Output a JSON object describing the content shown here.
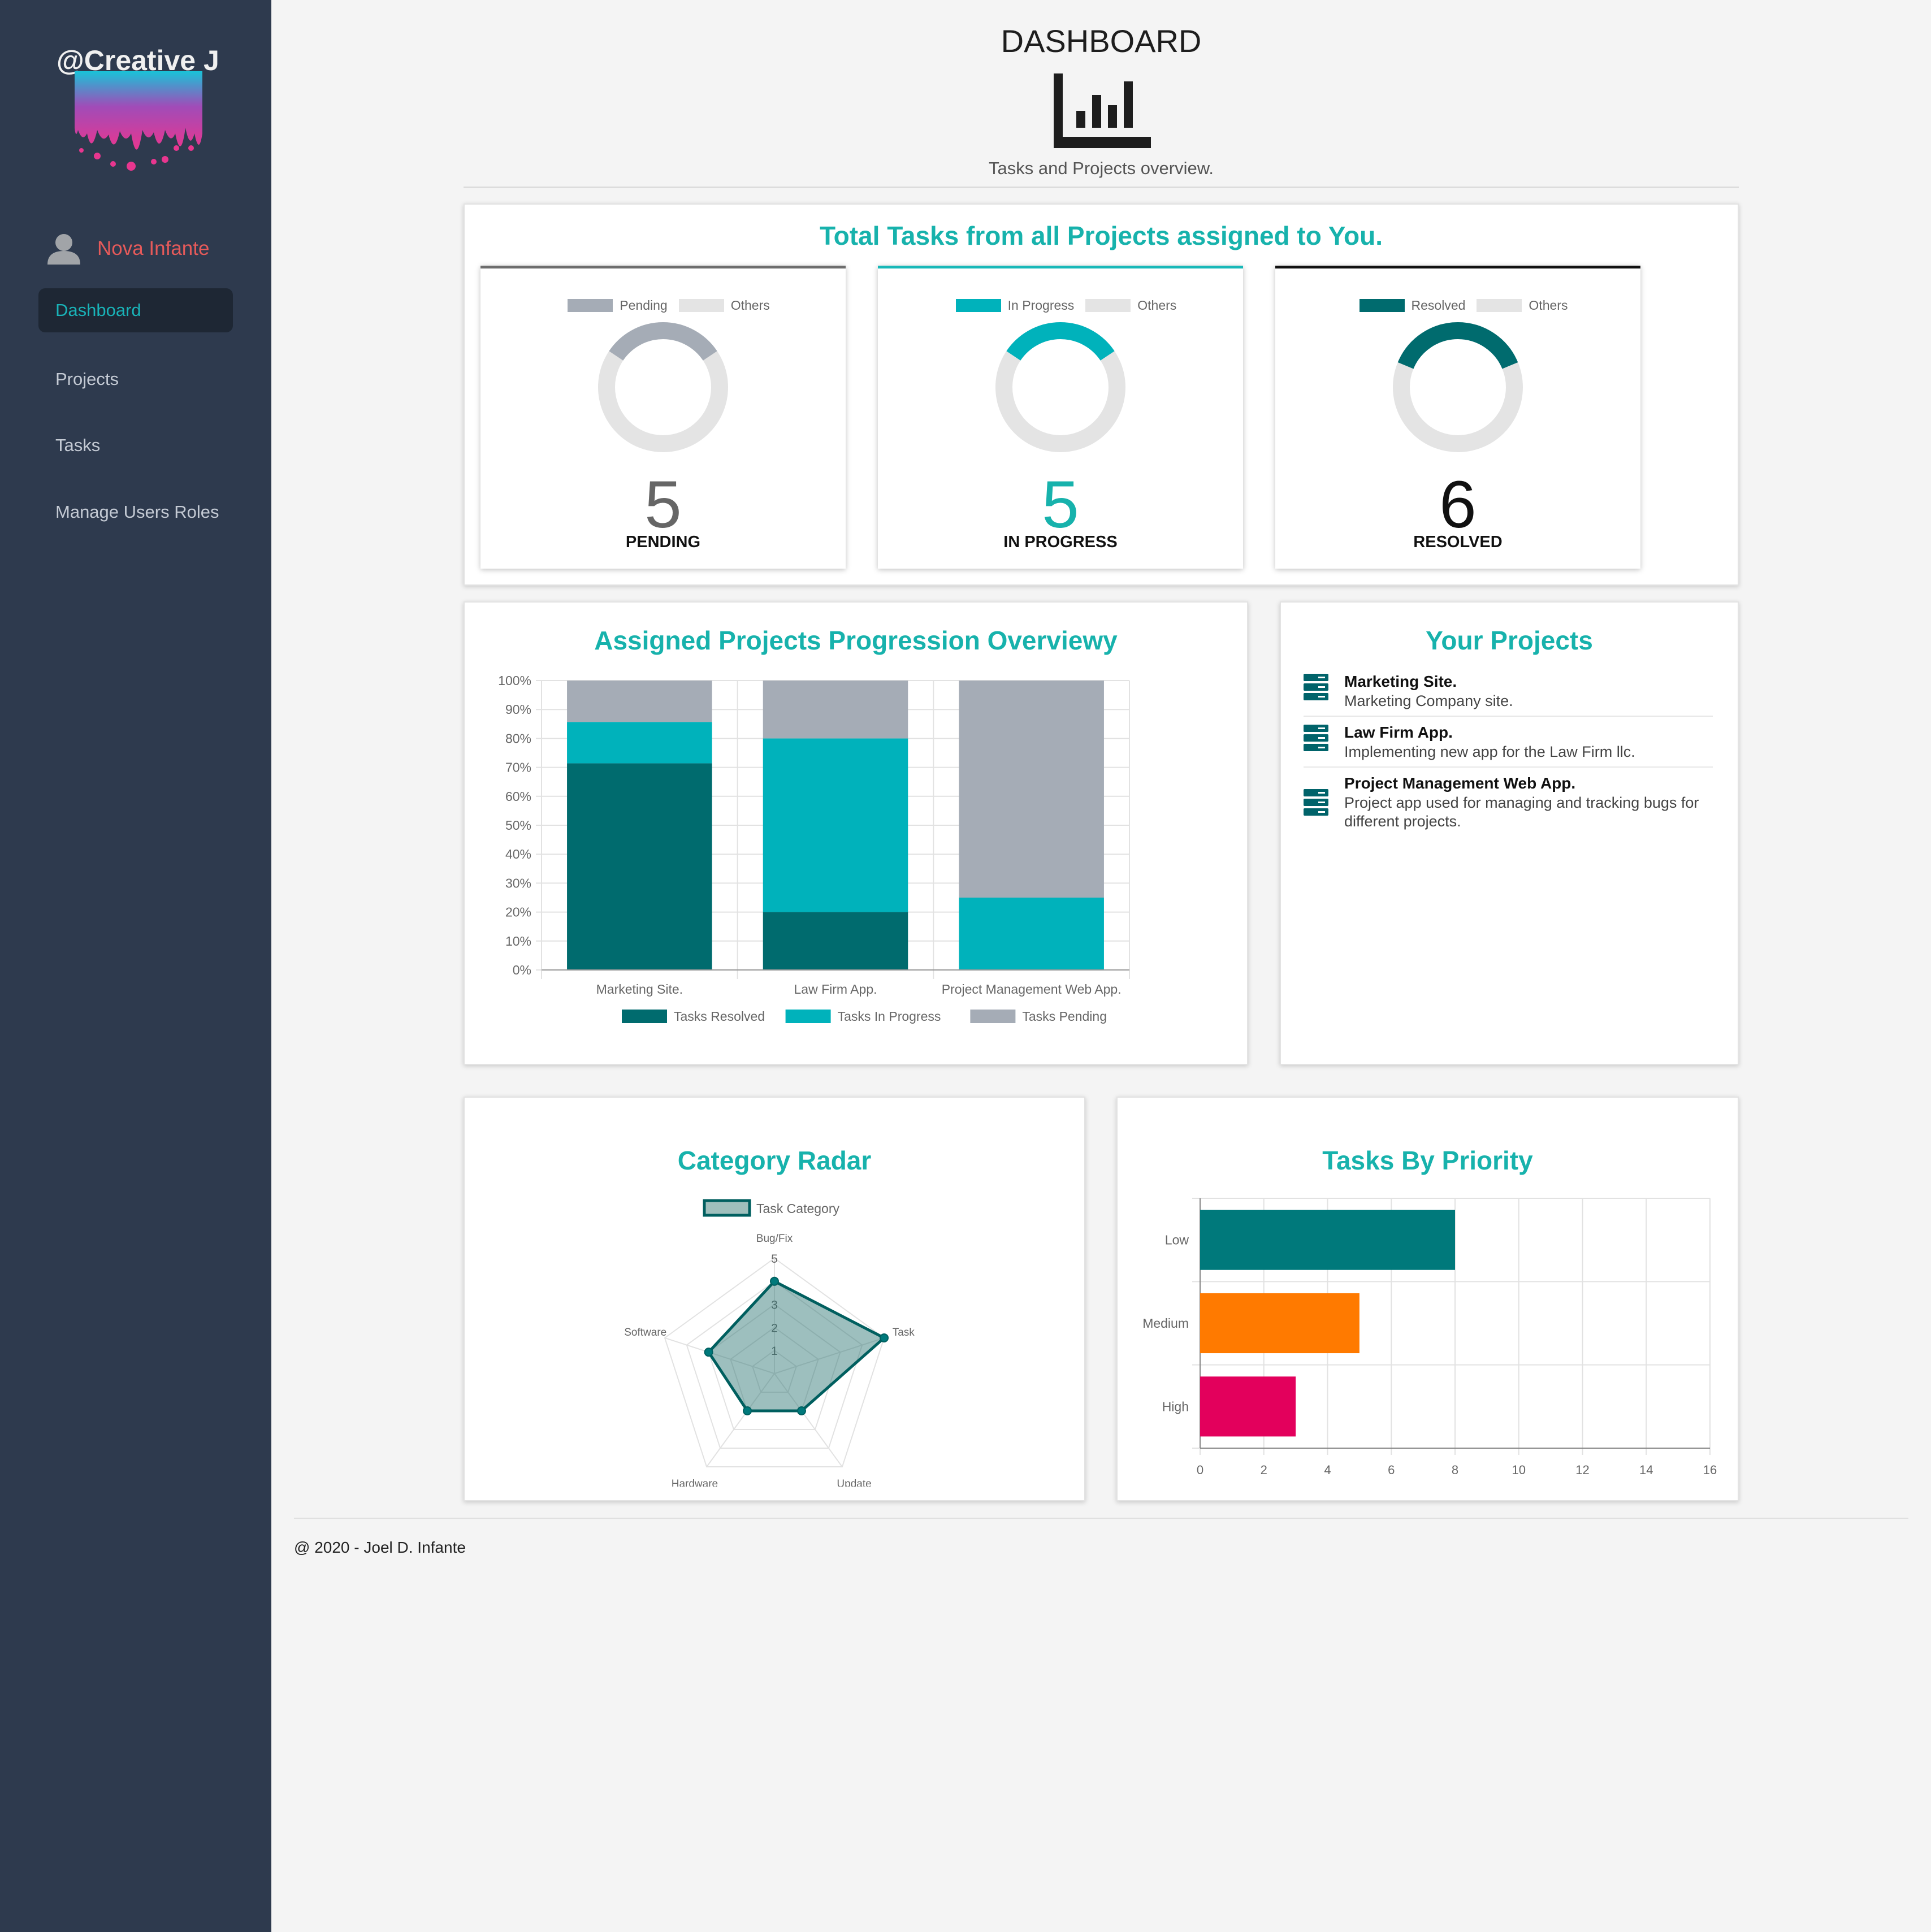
{
  "sidebar": {
    "brand": "@Creative J",
    "user_name": "Nova Infante",
    "nav": [
      {
        "label": "Dashboard"
      },
      {
        "label": "Projects"
      },
      {
        "label": "Tasks"
      },
      {
        "label": "Manage Users Roles"
      }
    ]
  },
  "header": {
    "title": "DASHBOARD",
    "subtitle": "Tasks and Projects overview."
  },
  "totals": {
    "title": "Total Tasks from all Projects assigned to You.",
    "pending": {
      "legend": "Pending",
      "others": "Others",
      "count": "5",
      "label": "PENDING",
      "fraction": 0.3125,
      "color": "#a5acb6"
    },
    "progress": {
      "legend": "In Progress",
      "others": "Others",
      "count": "5",
      "label": "IN PROGRESS",
      "fraction": 0.3125,
      "color": "#00b2bb"
    },
    "resolved": {
      "legend": "Resolved",
      "others": "Others",
      "count": "6",
      "label": "RESOLVED",
      "fraction": 0.375,
      "color": "#006b6e"
    }
  },
  "progression": {
    "title": "Assigned Projects Progression Overviewy"
  },
  "your_projects": {
    "title": "Your Projects",
    "items": [
      {
        "name": "Marketing Site.",
        "desc": "Marketing Company site."
      },
      {
        "name": "Law Firm App.",
        "desc": "Implementing new app for the Law Firm llc."
      },
      {
        "name": "Project Management Web App.",
        "desc": "Project app used for managing and tracking bugs for different projects."
      }
    ]
  },
  "radar": {
    "title": "Category Radar"
  },
  "priority": {
    "title": "Tasks By Priority"
  },
  "footer": {
    "text": "@ 2020 - Joel D. Infante"
  },
  "chart_data": [
    {
      "type": "bar",
      "stacked": true,
      "title": "Assigned Projects Progression Overviewy",
      "categories": [
        "Marketing Site.",
        "Law Firm App.",
        "Project Management Web App."
      ],
      "series": [
        {
          "name": "Tasks Resolved",
          "values": [
            71.4,
            20,
            0
          ],
          "color": "#006b6e"
        },
        {
          "name": "Tasks In Progress",
          "values": [
            14.3,
            60,
            25
          ],
          "color": "#00b2bb"
        },
        {
          "name": "Tasks Pending",
          "values": [
            14.3,
            20,
            75
          ],
          "color": "#a5acb6"
        }
      ],
      "yticks": [
        "0%",
        "10%",
        "20%",
        "30%",
        "40%",
        "50%",
        "60%",
        "70%",
        "80%",
        "90%",
        "100%"
      ],
      "ylim": [
        0,
        100
      ],
      "grid": true,
      "legend": "bottom"
    },
    {
      "type": "radar",
      "title": "Category Radar",
      "categories": [
        "Bug/Fix",
        "Task",
        "Update",
        "Hardware",
        "Software"
      ],
      "series": [
        {
          "name": "Task Category",
          "values": [
            4,
            5,
            2,
            2,
            3
          ]
        }
      ],
      "rticks": [
        "1",
        "2",
        "3",
        "5"
      ],
      "rlim": [
        0,
        5
      ],
      "legend": "top"
    },
    {
      "type": "bar",
      "orientation": "horizontal",
      "title": "Tasks By Priority",
      "categories": [
        "Low",
        "Medium",
        "High"
      ],
      "values": [
        8,
        5,
        3
      ],
      "colors": [
        "#00797b",
        "#ff7a00",
        "#e3005c"
      ],
      "xticks": [
        "0",
        "2",
        "4",
        "6",
        "8",
        "10",
        "12",
        "14",
        "16"
      ],
      "xlim": [
        0,
        16
      ],
      "grid": true
    }
  ]
}
